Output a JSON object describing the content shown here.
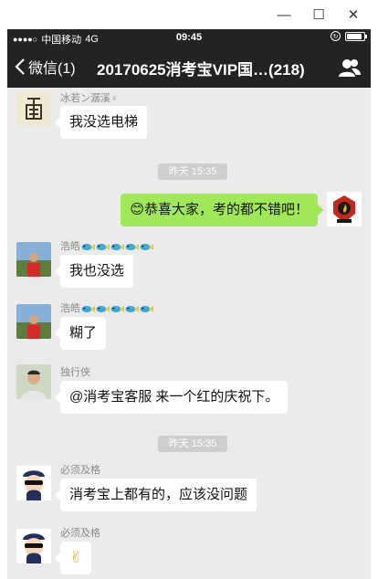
{
  "window": {
    "min_icon": "—",
    "max_icon": "☐",
    "close_icon": "✕"
  },
  "status_bar": {
    "signal_dots": "●●●●○",
    "carrier": "中国移动",
    "network": "4G",
    "time": "09:45",
    "battery_level": 0.9
  },
  "nav": {
    "back_label": "微信(1)",
    "title": "20170625消考宝VIP国…(218)",
    "group_icon": "group-members-icon"
  },
  "messages": [
    {
      "side": "left",
      "sender": "冰若ン潺溪♀",
      "text": "我没选电梯",
      "avatar": "seal-avatar"
    },
    {
      "type": "time",
      "text": "昨天 15:35"
    },
    {
      "side": "right",
      "emoji": "😊",
      "text": "恭喜大家，考的都不错吧！",
      "avatar": "firefighter-logo-avatar"
    },
    {
      "side": "left",
      "sender": "浩皓",
      "fish_count": 5,
      "text": "我也没选",
      "avatar": "photo-avatar"
    },
    {
      "side": "left",
      "sender": "浩皓",
      "fish_count": 5,
      "text": "糊了",
      "avatar": "photo-avatar"
    },
    {
      "side": "left",
      "sender": "独行侠",
      "text": "@消考宝客服 来一个红的庆祝下。",
      "avatar": "portrait-avatar"
    },
    {
      "type": "time",
      "text": "昨天 15:35"
    },
    {
      "side": "left",
      "sender": "必须及格",
      "text": "消考宝上都有的，应该没问题",
      "avatar": "cartoon-police-avatar"
    },
    {
      "side": "left",
      "sender": "必须及格",
      "text": "✌",
      "avatar": "cartoon-police-avatar"
    }
  ],
  "colors": {
    "nav_bg": "#232323",
    "chat_bg": "#ebebeb",
    "bubble_right": "#a0e75a",
    "bubble_left": "#ffffff"
  }
}
